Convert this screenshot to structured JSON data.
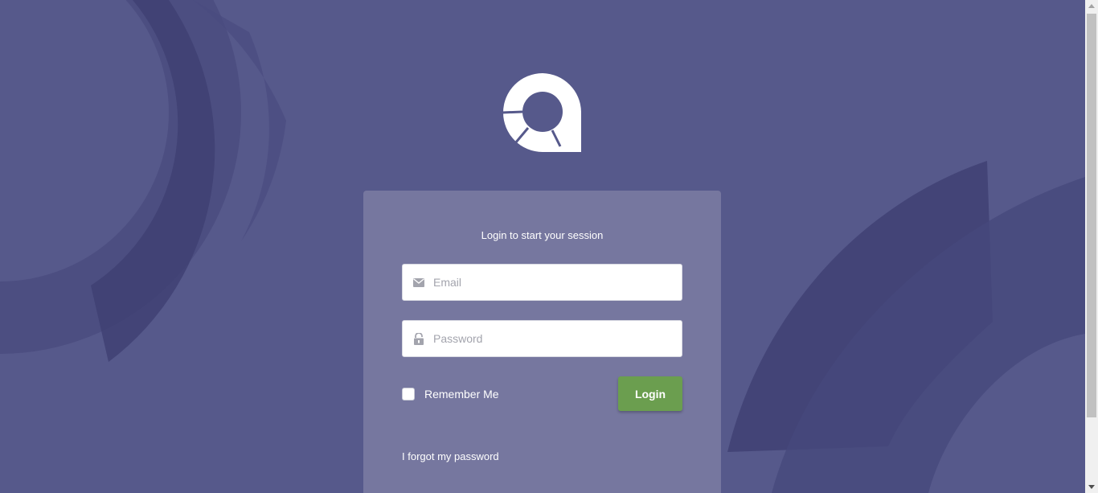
{
  "login_box": {
    "title": "Login to start your session",
    "email": {
      "placeholder": "Email",
      "icon": "envelope-icon"
    },
    "password": {
      "placeholder": "Password",
      "icon": "unlock-icon"
    },
    "remember_label": "Remember Me",
    "remember_checked": false,
    "login_label": "Login",
    "forgot_label": "I forgot my password"
  },
  "colors": {
    "background": "#56598b",
    "card": "#76779f",
    "button": "#6b9e4f",
    "decoration": "#3f4173"
  },
  "logo": {
    "icon": "app-logo-icon"
  }
}
